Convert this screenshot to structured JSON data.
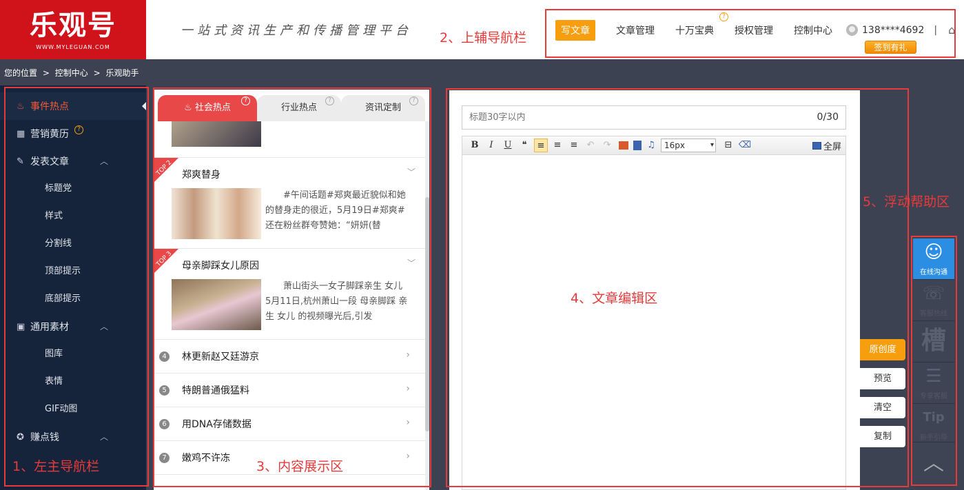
{
  "header": {
    "logo_text": "乐观号",
    "logo_url": "WWW.MYLEGUAN.COM",
    "slogan": "一站式资讯生产和传播管理平台",
    "nav": [
      {
        "label": "写文章",
        "active": true
      },
      {
        "label": "文章管理"
      },
      {
        "label": "十万宝典",
        "help": "?"
      },
      {
        "label": "授权管理"
      },
      {
        "label": "控制中心"
      }
    ],
    "user_phone": "138****4692",
    "divider": "|",
    "home_icon": "home-icon",
    "signin_label": "签到有礼"
  },
  "breadcrumb": [
    "您的位置",
    ">",
    "控制中心",
    ">",
    "乐观助手"
  ],
  "sidebar": {
    "items": [
      {
        "label": "事件热点",
        "icon": "flame-icon",
        "glyph": "♨",
        "active": true
      },
      {
        "label": "营销黄历",
        "icon": "calendar-icon",
        "glyph": "▦",
        "help": "?"
      },
      {
        "label": "发表文章",
        "icon": "edit-icon",
        "glyph": "✎",
        "chevron": "︿"
      },
      {
        "label": "标题党",
        "sub": true
      },
      {
        "label": "样式",
        "sub": true
      },
      {
        "label": "分割线",
        "sub": true
      },
      {
        "label": "顶部提示",
        "sub": true
      },
      {
        "label": "底部提示",
        "sub": true
      },
      {
        "label": "通用素材",
        "icon": "image-icon",
        "glyph": "▣",
        "chevron": "︿"
      },
      {
        "label": "图库",
        "sub": true
      },
      {
        "label": "表情",
        "sub": true
      },
      {
        "label": "GIF动图",
        "sub": true
      },
      {
        "label": "赚点钱",
        "icon": "money-icon",
        "glyph": "✪",
        "chevron": "︿"
      }
    ]
  },
  "content": {
    "tabs": [
      {
        "label": "社会热点",
        "help": "?",
        "icon": "♨"
      },
      {
        "label": "行业热点",
        "help": "?"
      },
      {
        "label": "资讯定制",
        "help": "?"
      }
    ],
    "cards": [
      {
        "rank": "TOP 2",
        "title": "郑爽替身",
        "summary": "#午间话题#郑爽最近貌似和她的替身走的很近，5月19日#郑爽#还在粉丝群夸赞她：“妍妍(替",
        "chevron": "﹀"
      },
      {
        "rank": "TOP 3",
        "title": "母亲脚踩女儿原因",
        "summary": "萧山街头一女子脚踩亲生 女儿 5月11日,杭州萧山一段 母亲脚踩 亲生 女儿 的视频曝光后,引发",
        "chevron": "﹀"
      }
    ],
    "rows": [
      {
        "num": "4",
        "title": "林更新赵又廷游京"
      },
      {
        "num": "5",
        "title": "特朗普通俄猛料"
      },
      {
        "num": "6",
        "title": "用DNA存储数据"
      },
      {
        "num": "7",
        "title": "嫩鸡不许冻"
      }
    ],
    "chevron_right": "›"
  },
  "editor": {
    "title_placeholder": "标题30字以内",
    "title_count": "0/30",
    "toolbar": {
      "bold": "B",
      "italic": "I",
      "underline": "U",
      "quote": "❝",
      "align_left": "≡",
      "align_center": "≡",
      "align_right": "≡",
      "undo": "↶",
      "redo": "↷",
      "music": "♫",
      "font_size": "16px",
      "format": "⊟",
      "eraser": "⌫",
      "fullscreen": "全屏"
    }
  },
  "actions": [
    "原创度",
    "预览",
    "清空",
    "复制"
  ],
  "float_help": [
    {
      "label": "在线沟通",
      "icon": "chat-icon",
      "glyph": "☺",
      "active": true
    },
    {
      "label": "客服热线",
      "icon": "phone-icon",
      "glyph": "☏"
    },
    {
      "label": "",
      "icon": "slot-icon",
      "glyph": "槽"
    },
    {
      "label": "专享客服",
      "icon": "service-icon",
      "glyph": "☰"
    },
    {
      "label": "新手引导",
      "icon": "tip-icon",
      "glyph": "Tip"
    }
  ],
  "back_to_top": "︿",
  "annotations": [
    "1、左主导航栏",
    "2、上辅导航栏",
    "3、内容展示区",
    "4、文章编辑区",
    "5、浮动帮助区"
  ],
  "colors": {
    "brand_red": "#d0121b",
    "accent_orange": "#f79e0f",
    "sidebar_bg": "#15243b",
    "page_bg": "#3c4252",
    "annotation_red": "#e83a3a"
  }
}
